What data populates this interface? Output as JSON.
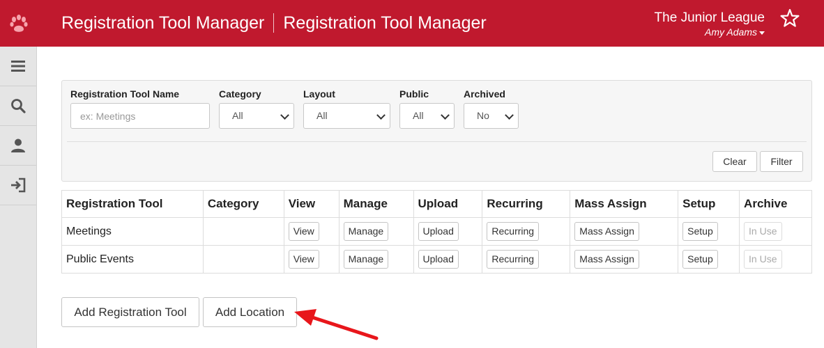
{
  "header": {
    "title_left": "Registration Tool Manager",
    "title_right": "Registration Tool Manager",
    "org_name": "The Junior League",
    "user_name": "Amy Adams",
    "logo_icon": "paw-icon",
    "favorite_icon": "star-outline-icon",
    "brand_color": "#c0192e"
  },
  "sidebar": {
    "items": [
      {
        "name": "menu",
        "icon": "hamburger-icon"
      },
      {
        "name": "search",
        "icon": "search-icon"
      },
      {
        "name": "profile",
        "icon": "user-icon"
      },
      {
        "name": "logout",
        "icon": "logout-icon"
      }
    ]
  },
  "filters": {
    "name_label": "Registration Tool Name",
    "name_placeholder": "ex: Meetings",
    "category_label": "Category",
    "category_value": "All",
    "layout_label": "Layout",
    "layout_value": "All",
    "public_label": "Public",
    "public_value": "All",
    "archived_label": "Archived",
    "archived_value": "No",
    "clear_label": "Clear",
    "filter_label": "Filter"
  },
  "table": {
    "headers": [
      "Registration Tool",
      "Category",
      "View",
      "Manage",
      "Upload",
      "Recurring",
      "Mass Assign",
      "Setup",
      "Archive"
    ],
    "rows": [
      {
        "name": "Meetings",
        "category": "",
        "view": "View",
        "manage": "Manage",
        "upload": "Upload",
        "recurring": "Recurring",
        "mass_assign": "Mass Assign",
        "setup": "Setup",
        "archive": "In Use"
      },
      {
        "name": "Public Events",
        "category": "",
        "view": "View",
        "manage": "Manage",
        "upload": "Upload",
        "recurring": "Recurring",
        "mass_assign": "Mass Assign",
        "setup": "Setup",
        "archive": "In Use"
      }
    ]
  },
  "actions": {
    "add_tool_label": "Add Registration Tool",
    "add_location_label": "Add Location"
  },
  "annotation": {
    "arrow_color": "#e8161b"
  }
}
